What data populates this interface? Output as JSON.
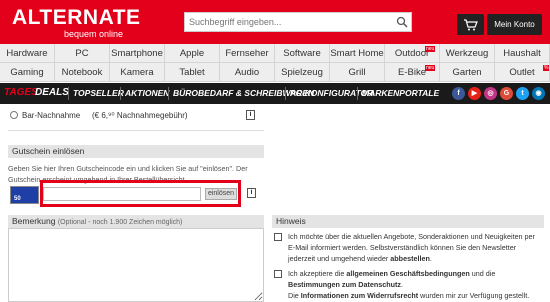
{
  "header": {
    "logo": "ALTERNATE",
    "tagline": "bequem online",
    "search_placeholder": "Suchbegriff eingeben...",
    "account_label": "Mein Konto",
    "brand_color": "#e3001b"
  },
  "nav": {
    "row1": [
      "Hardware",
      "PC",
      "Smartphone",
      "Apple",
      "Fernseher",
      "Software",
      "Smart Home",
      "Outdoor",
      "Werkzeug",
      "Haushalt"
    ],
    "row2": [
      "Gaming",
      "Notebook",
      "Kamera",
      "Tablet",
      "Audio",
      "Spielzeug",
      "Grill",
      "E-Bike",
      "Garten",
      "Outlet"
    ],
    "badge_neu": "neu",
    "badge_percent": "%"
  },
  "deals_bar": {
    "tages": "TAGES",
    "deals": "DEALS",
    "links": [
      "TOPSELLER",
      "AKTIONEN",
      "BÜROBEDARF & SCHREIBWAREN",
      "PC-KONFIGURATOR",
      "MARKENPORTALE"
    ],
    "social": [
      "f",
      "▶",
      "◎",
      "G",
      "t",
      "◉"
    ]
  },
  "payment": {
    "label": "Bar-Nachnahme",
    "fee": "(€ 6,⁹⁰ Nachnahmegebühr)",
    "info": "i"
  },
  "voucher": {
    "title": "Gutschein einlösen",
    "description": "Geben Sie hier Ihren Gutscheincode ein und klicken Sie auf \"einlösen\". Der Gutschein erscheint umgehend in Ihrer Bestellübersicht.",
    "logo_text": "50",
    "button": "einlösen",
    "info": "i"
  },
  "remark": {
    "title": "Bemerkung",
    "hint": "(Optional - noch 1.900 Zeichen möglich)"
  },
  "notice": {
    "title": "Hinweis",
    "item1_pre": "Ich möchte über die aktuellen Angebote, Sonderaktionen und Neuigkeiten per E-Mail informiert werden. Selbstverständlich können Sie den Newsletter jederzeit und umgehend wieder ",
    "item1_bold": "abbestellen",
    "item1_post": ".",
    "item2_pre": "Ich akzeptiere die ",
    "item2_bold1": "allgemeinen Geschäftsbedingungen",
    "item2_mid": " und die ",
    "item2_bold2": "Bestimmungen zum Datenschutz",
    "item2_post": ".",
    "item3_pre": "Die ",
    "item3_bold": "Informationen zum Widerrufsrecht",
    "item3_post": " wurden mir zur Verfügung gestellt."
  }
}
